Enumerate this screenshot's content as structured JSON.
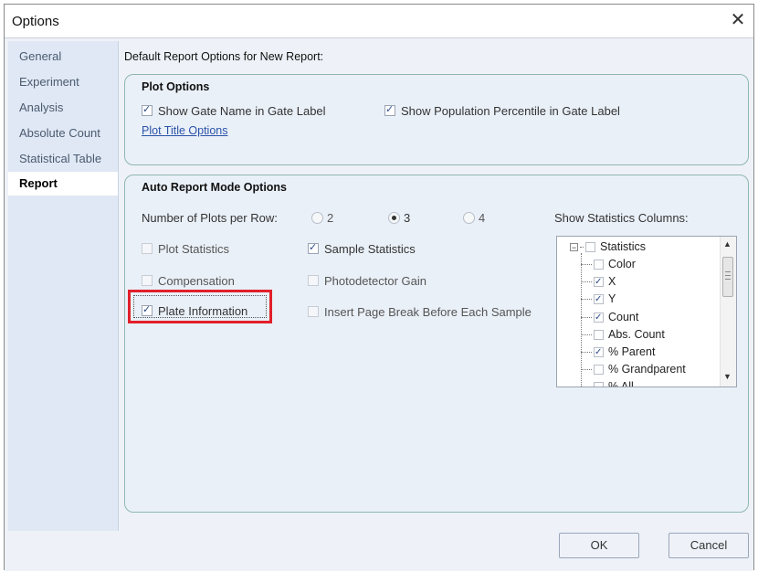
{
  "window": {
    "title": "Options",
    "close_symbol": "✕"
  },
  "sidebar": {
    "items": [
      {
        "label": "General"
      },
      {
        "label": "Experiment"
      },
      {
        "label": "Analysis"
      },
      {
        "label": "Absolute Count"
      },
      {
        "label": "Statistical Table"
      },
      {
        "label": "Report",
        "active": true
      }
    ]
  },
  "content": {
    "header": "Default Report Options for New Report:",
    "plot_options": {
      "title": "Plot Options",
      "show_gate_name": {
        "label": "Show Gate Name in Gate Label",
        "checked": true
      },
      "show_population_percentile": {
        "label": "Show Population Percentile in Gate Label",
        "checked": true
      },
      "plot_title_options_link": "Plot Title Options"
    },
    "auto_report": {
      "title": "Auto Report Mode Options",
      "plots_per_row_label": "Number of Plots per Row:",
      "plots_per_row_options": [
        "2",
        "3",
        "4"
      ],
      "plots_per_row_selected": "3",
      "checkboxes": {
        "plot_statistics": {
          "label": "Plot Statistics",
          "checked": false
        },
        "sample_statistics": {
          "label": "Sample Statistics",
          "checked": true
        },
        "compensation": {
          "label": "Compensation",
          "checked": false
        },
        "photodetector_gain": {
          "label": "Photodetector Gain",
          "checked": false
        },
        "plate_information": {
          "label": "Plate Information",
          "checked": true
        },
        "insert_page_break": {
          "label": "Insert Page Break Before Each Sample",
          "checked": false
        }
      },
      "statistics_columns_label": "Show Statistics Columns:",
      "statistics_tree": {
        "root": {
          "label": "Statistics",
          "expander": "−",
          "checked": false
        },
        "children": [
          {
            "label": "Color",
            "checked": false
          },
          {
            "label": "X",
            "checked": true
          },
          {
            "label": "Y",
            "checked": true
          },
          {
            "label": "Count",
            "checked": true
          },
          {
            "label": "Abs. Count",
            "checked": false
          },
          {
            "label": "% Parent",
            "checked": true
          },
          {
            "label": "% Grandparent",
            "checked": false
          },
          {
            "label": "% All",
            "checked": false
          }
        ]
      }
    }
  },
  "buttons": {
    "ok": "OK",
    "cancel": "Cancel"
  },
  "colors": {
    "highlight": "#e1202a",
    "link": "#2a53a8",
    "active_nav_bg": "#ffffff"
  }
}
